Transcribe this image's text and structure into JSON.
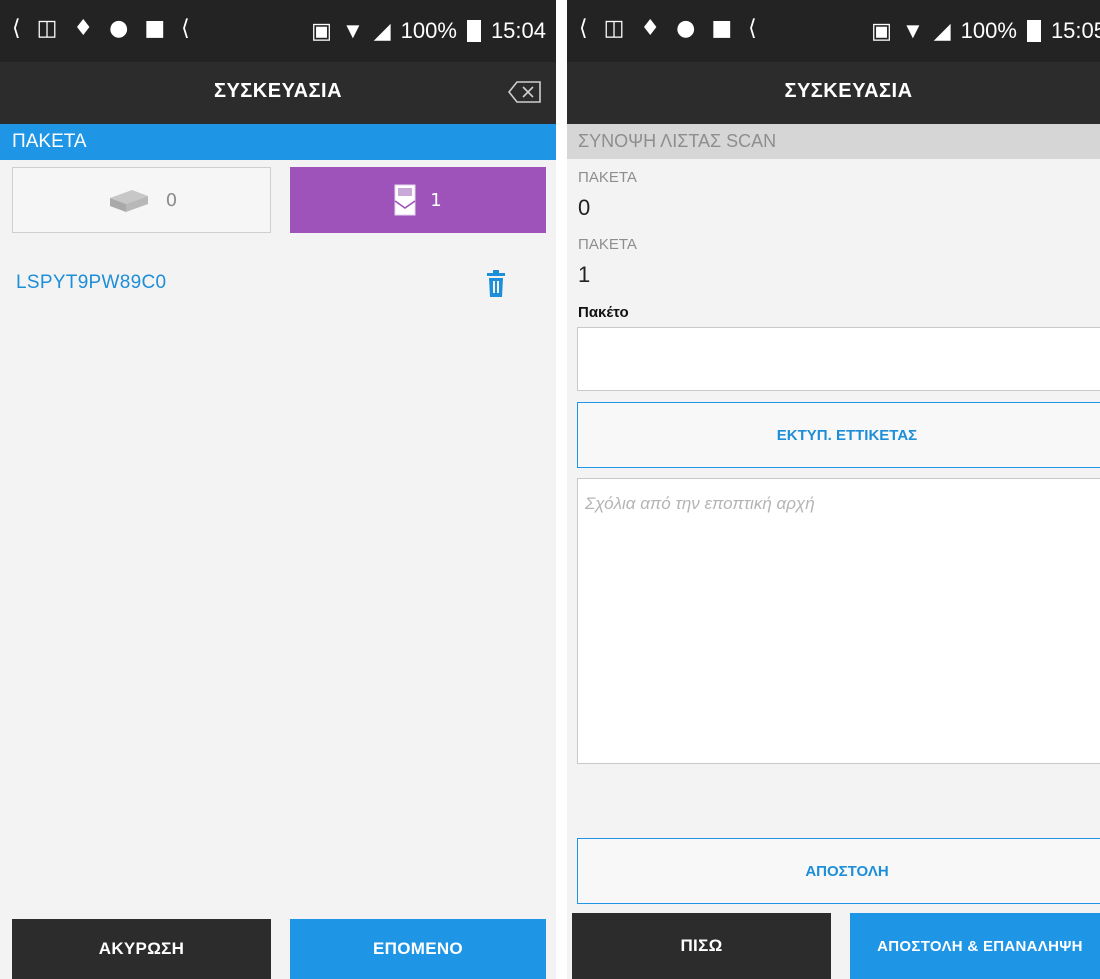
{
  "colors": {
    "primary_blue": "#1f95e6",
    "dark_bar": "#2c2c2c",
    "purple_tab": "#9d53b9",
    "background": "#f3f3f3",
    "summary_bar": "#d6d6d6"
  },
  "left": {
    "status": {
      "battery": "100%",
      "time": "15:04"
    },
    "app_title": "ΣΥΣΚΕΥΑΣΙΑ",
    "section_title": "ΠΑΚΕΤΑ",
    "tabs": [
      {
        "icon": "box-icon",
        "count": "0",
        "selected": false
      },
      {
        "icon": "packet-icon",
        "count": "1",
        "selected": true
      }
    ],
    "items": [
      {
        "code": "LSPYT9PW89C0",
        "icon": "trash-icon"
      }
    ],
    "buttons": {
      "cancel": "ΑΚΥΡΩΣΗ",
      "next": "ΕΠΟΜΕΝΟ"
    }
  },
  "right": {
    "status": {
      "battery": "100%",
      "time": "15:05"
    },
    "app_title": "ΣΥΣΚΕΥΑΣΙΑ",
    "summary_title": "ΣΥΝΟΨΗ ΛΙΣΤΑΣ SCAN",
    "fields": [
      {
        "label": "ΠΑΚΕΤΑ",
        "value": "0"
      },
      {
        "label": "ΠΑΚΕΤΑ",
        "value": "1"
      }
    ],
    "packet_label": "Πακέτο",
    "print_label_button": "ΕΚΤΥΠ. ΕΤΤΙΚΕΤΑΣ",
    "comments_placeholder": "Σχόλια από την εποπτική αρχή",
    "send_button": "ΑΠΟΣΤΟΛΗ",
    "buttons": {
      "back": "ΠΙΣΩ",
      "send_repeat": "ΑΠΟΣΤΟΛΗ & ΕΠΑΝΑΛΗΨΗ"
    }
  }
}
